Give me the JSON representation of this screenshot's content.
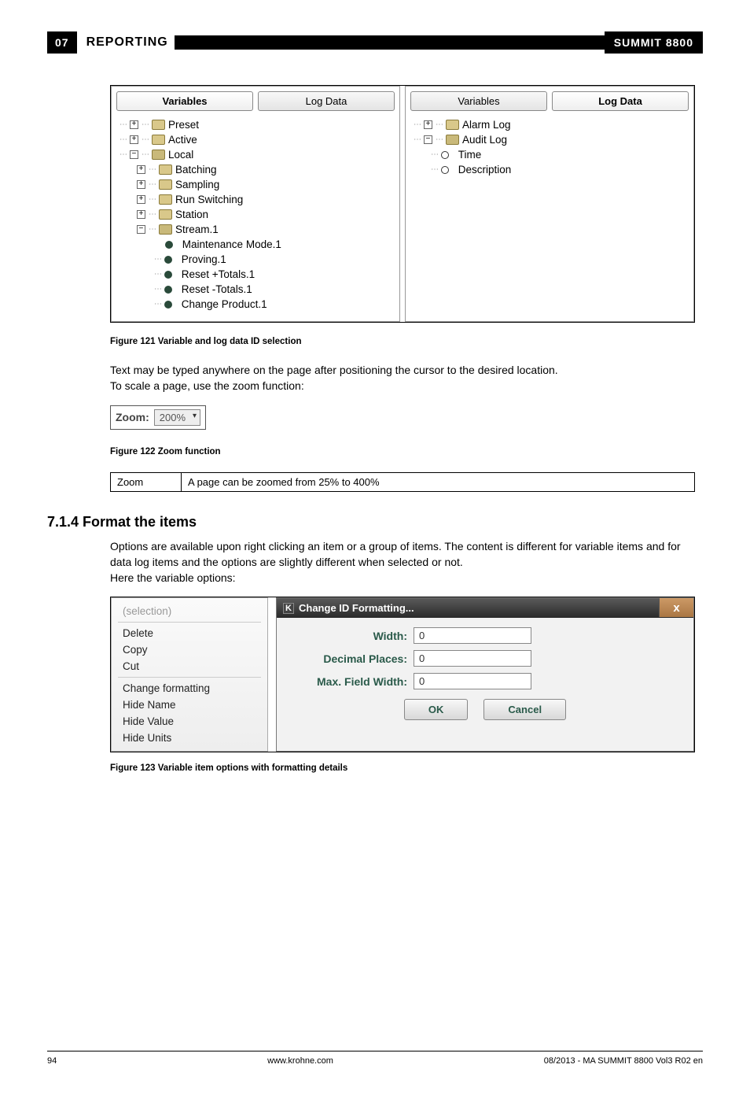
{
  "header": {
    "chapter": "07",
    "title": "REPORTING",
    "product": "SUMMIT 8800"
  },
  "tree_left": {
    "tabs": {
      "active": "Variables",
      "other": "Log Data"
    },
    "items": {
      "preset": "Preset",
      "active": "Active",
      "local": "Local",
      "batching": "Batching",
      "sampling": "Sampling",
      "run_switching": "Run Switching",
      "station": "Station",
      "stream1": "Stream.1",
      "maint": "Maintenance Mode.1",
      "proving": "Proving.1",
      "reset_plus": "Reset +Totals.1",
      "reset_minus": "Reset -Totals.1",
      "change_prod": "Change Product.1"
    }
  },
  "tree_right": {
    "tabs": {
      "other": "Variables",
      "active": "Log Data"
    },
    "items": {
      "alarm": "Alarm Log",
      "audit": "Audit Log",
      "time": "Time",
      "desc": "Description"
    }
  },
  "fig121": "Figure 121    Variable and log data ID selection",
  "body1a": "Text may be typed anywhere on the page after positioning the cursor to the desired location.",
  "body1b": "To scale a page, use the zoom function:",
  "zoom": {
    "label": "Zoom:",
    "value": "200%"
  },
  "fig122": "Figure 122    Zoom function",
  "zoom_table": {
    "name": "Zoom",
    "desc": "A page can be zoomed from 25% to 400%"
  },
  "section": "7.1.4 Format the items",
  "body2a": "Options are available upon right clicking an item or a group of items. The content is different for variable items and for data log items and the options are slightly different when selected or not.",
  "body2b": "Here the variable options:",
  "menu": {
    "selection": "(selection)",
    "delete": "Delete",
    "copy": "Copy",
    "cut": "Cut",
    "change_formatting": "Change formatting",
    "hide_name": "Hide Name",
    "hide_value": "Hide Value",
    "hide_units": "Hide Units"
  },
  "dialog": {
    "title": "Change ID Formatting...",
    "width_label": "Width:",
    "width_val": "0",
    "decimal_label": "Decimal Places:",
    "decimal_val": "0",
    "maxfw_label": "Max. Field Width:",
    "maxfw_val": "0",
    "ok": "OK",
    "cancel": "Cancel"
  },
  "fig123": "Figure 123    Variable item options with formatting details",
  "footer": {
    "page": "94",
    "url": "www.krohne.com",
    "doc": "08/2013 - MA SUMMIT 8800 Vol3 R02 en"
  }
}
